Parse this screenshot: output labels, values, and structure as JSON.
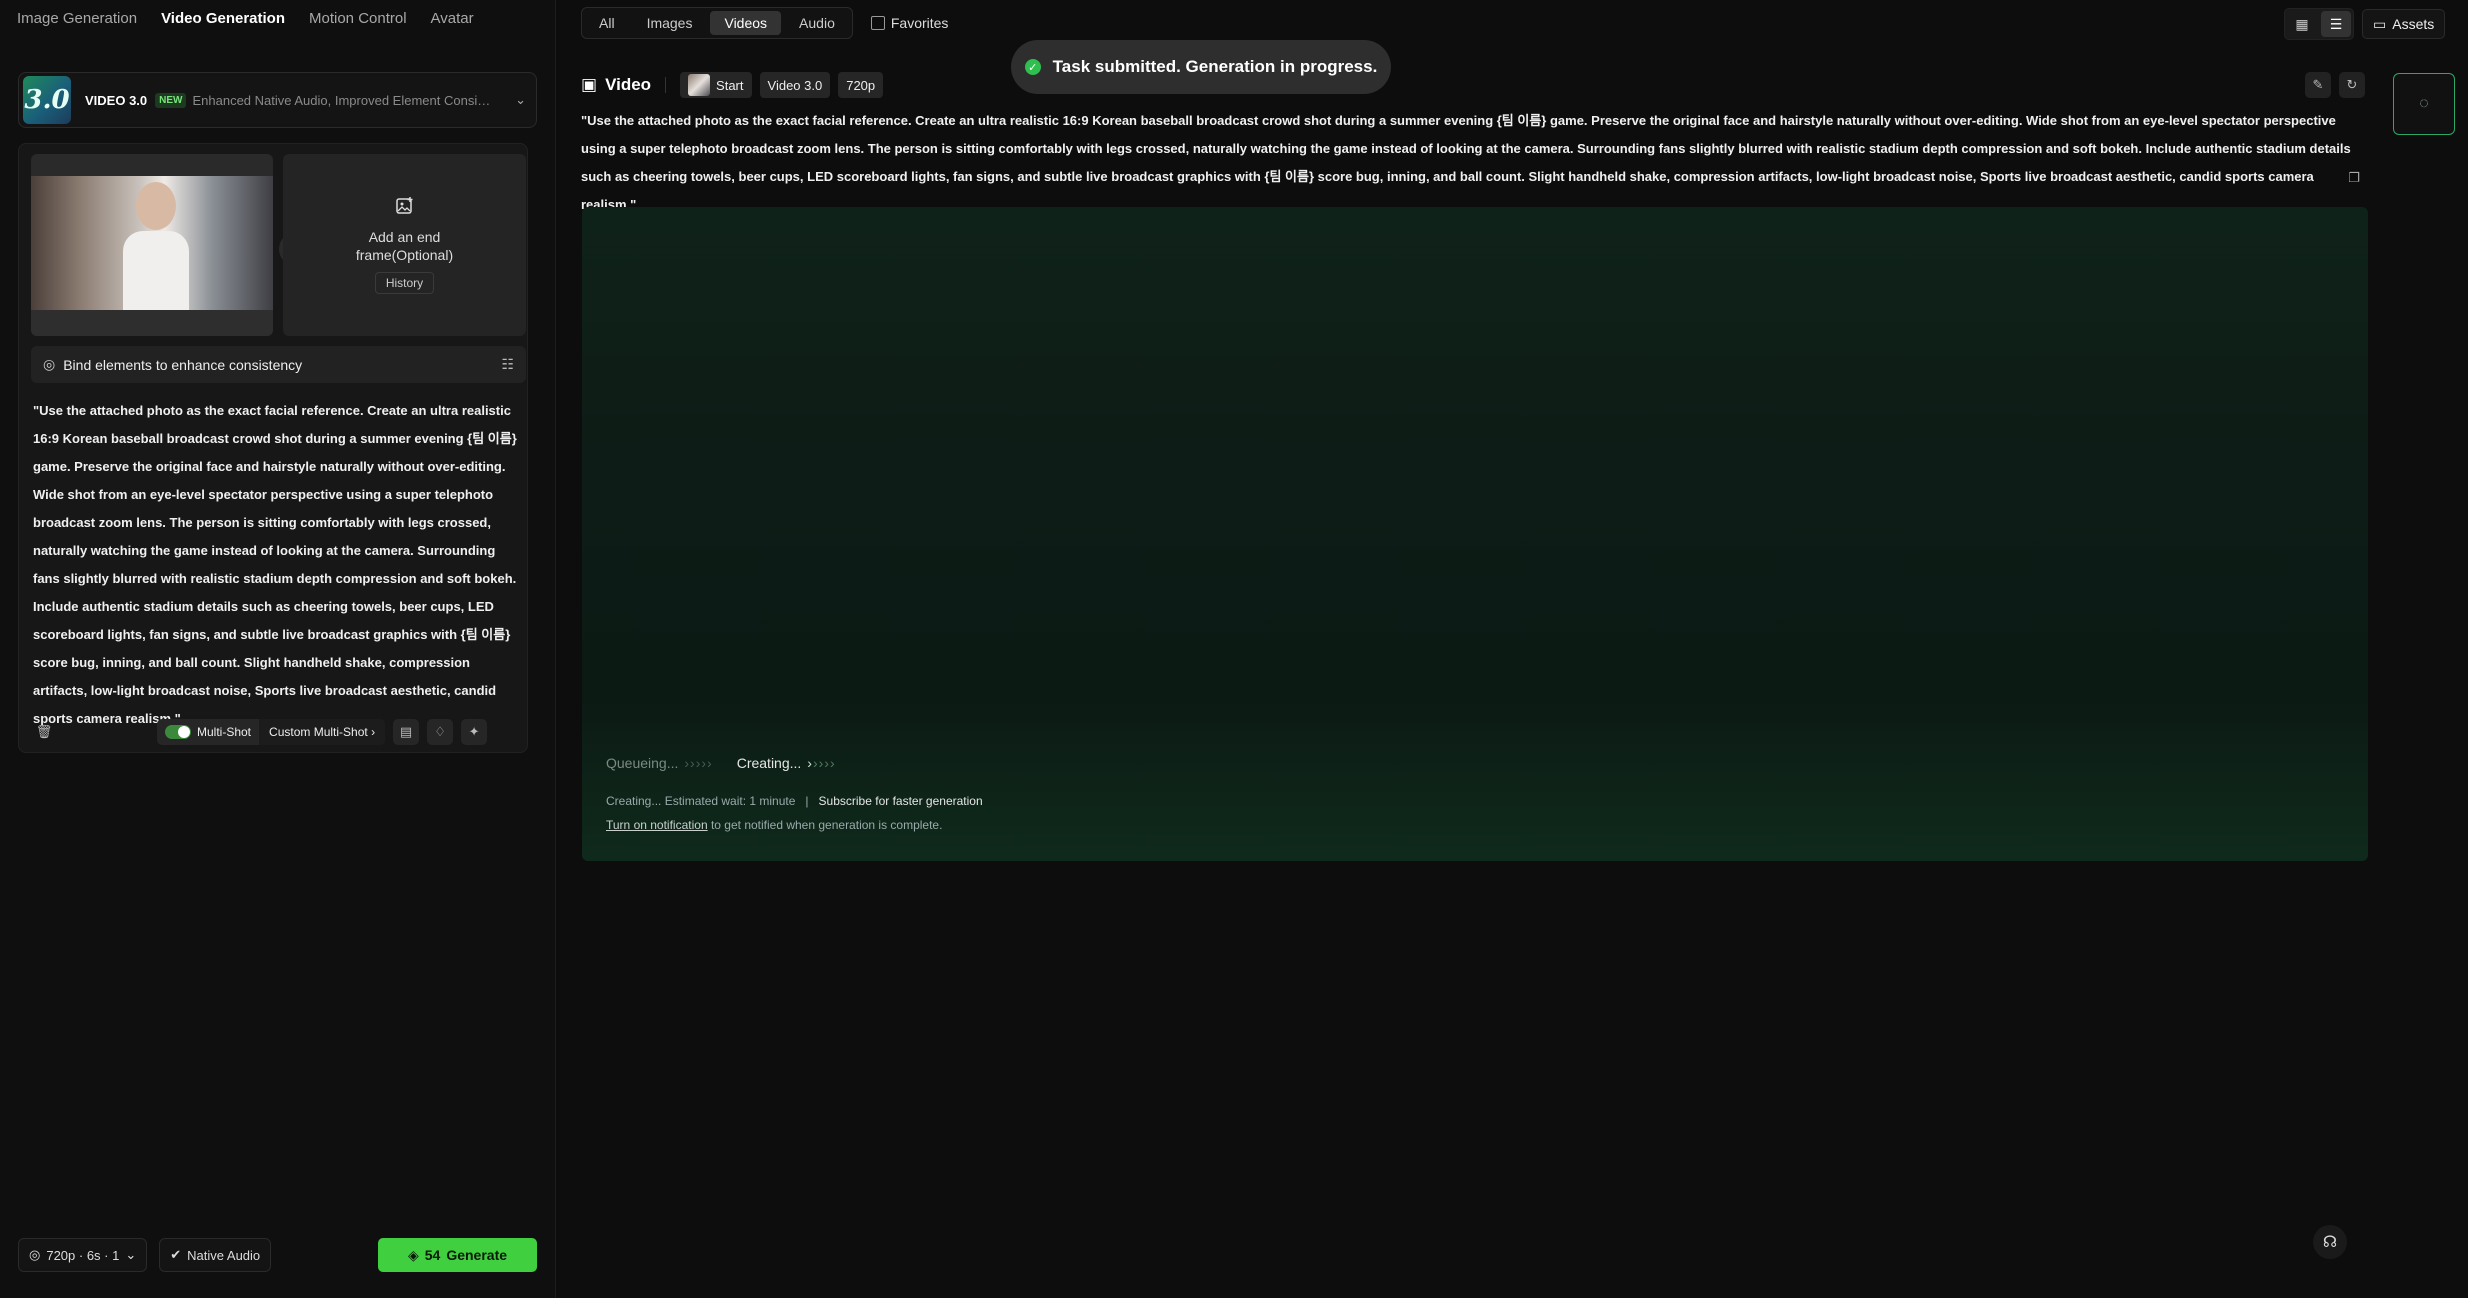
{
  "nav": {
    "tabs": [
      "Image Generation",
      "Video Generation",
      "Motion Control",
      "Avatar"
    ]
  },
  "model": {
    "logo": "3.0",
    "name": "VIDEO 3.0",
    "badge": "NEW",
    "desc": "Enhanced Native Audio, Improved Element Consisten..."
  },
  "frames": {
    "end_title": "Add an end frame(Optional)",
    "history": "History"
  },
  "bind": {
    "label": "Bind elements to enhance consistency"
  },
  "prompt": "\"Use the attached photo as the exact facial reference. Create an ultra realistic 16:9 Korean baseball broadcast crowd shot during a summer evening {팀 이름} game. Preserve the original face and hairstyle naturally without over-editing. Wide shot from an eye-level spectator perspective using a super telephoto broadcast zoom lens. The person is sitting comfortably with legs crossed, naturally watching the game instead of looking at the camera. Surrounding fans slightly blurred with realistic stadium depth compression and soft bokeh. Include authentic stadium details such as cheering towels, beer cups, LED scoreboard lights, fan signs, and subtle live broadcast graphics with {팀 이름} score bug, inning, and ball count. Slight handheld shake, compression artifacts, low-light broadcast noise, Sports live broadcast aesthetic, candid sports camera realism.\"",
  "tools": {
    "multishot": "Multi-Shot",
    "custom": "Custom Multi-Shot"
  },
  "bottom": {
    "settings": "720p · 6s · 1",
    "audio": "Native Audio",
    "credits": "54",
    "generate": "Generate"
  },
  "filters": {
    "tabs": [
      "All",
      "Images",
      "Videos",
      "Audio"
    ],
    "active": "Videos",
    "favorites": "Favorites"
  },
  "toast": "Task submitted. Generation in progress.",
  "assets": "Assets",
  "video": {
    "title": "Video",
    "start": "Start",
    "model": "Video 3.0",
    "res": "720p"
  },
  "status": {
    "queue": "Queueing...",
    "create": "Creating...",
    "wait": "Creating... Estimated wait: 1 minute",
    "subscribe": "Subscribe for faster generation",
    "notify_link": "Turn on notification",
    "notify_rest": " to get notified when generation is complete."
  },
  "colors": {
    "accent": "#3fcf3f",
    "toast_ok": "#2fbf4f"
  }
}
